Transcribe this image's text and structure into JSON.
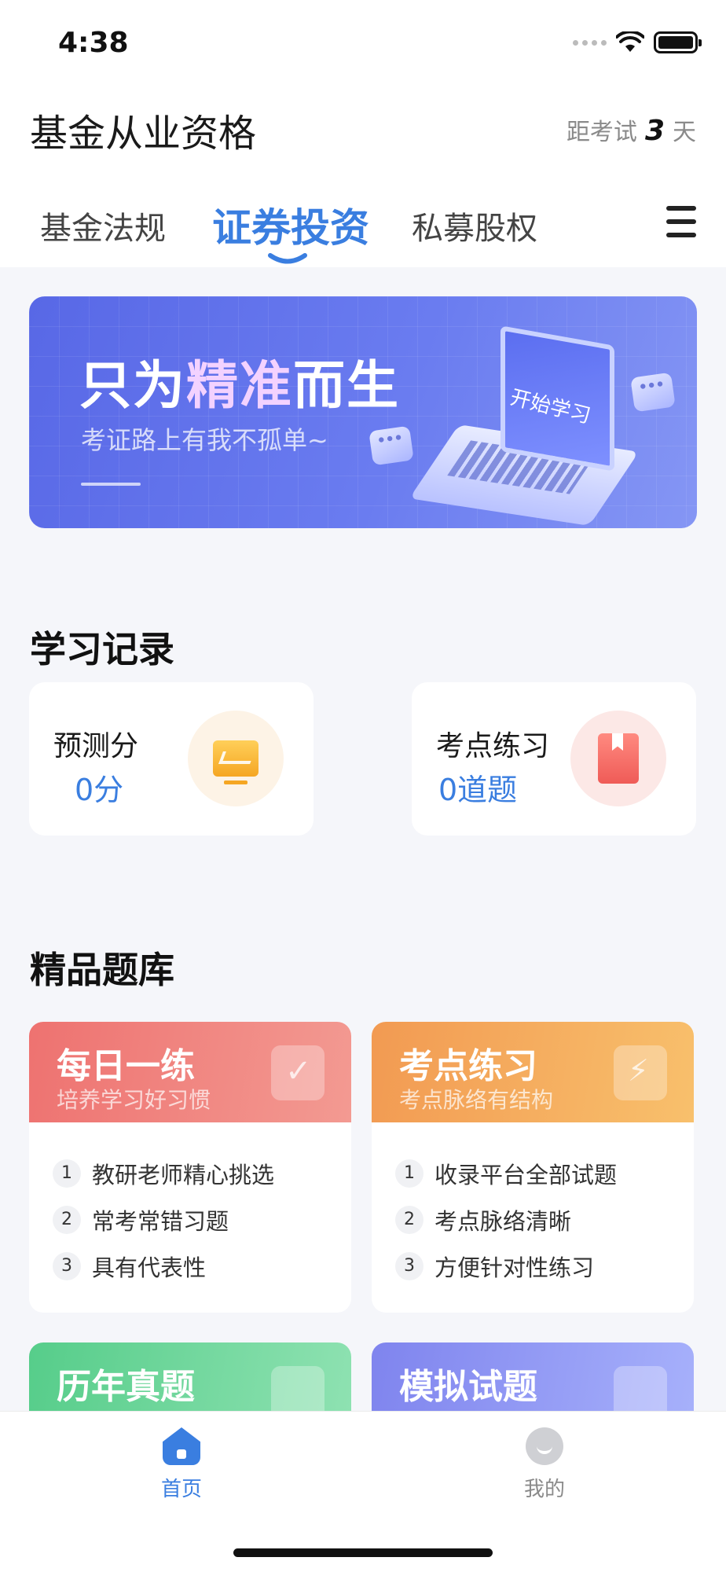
{
  "status_bar": {
    "time": "4:38"
  },
  "header": {
    "title": "基金从业资格",
    "exam_prefix": "距考试",
    "exam_days": "3",
    "exam_suffix": "天"
  },
  "tabs": [
    {
      "label": "基金法规"
    },
    {
      "label": "证券投资",
      "active": true
    },
    {
      "label": "私募股权"
    }
  ],
  "banner": {
    "title_part1": "只为",
    "title_highlight": "精准",
    "title_part2": "而生",
    "subtitle": "考证路上有我不孤单~",
    "screen_text": "开始学习"
  },
  "study_record": {
    "title": "学习记录",
    "cards": [
      {
        "label": "预测分",
        "value": "0分",
        "icon": "chart-icon"
      },
      {
        "label": "考点练习",
        "value": "0道题",
        "icon": "book-icon"
      }
    ]
  },
  "question_bank": {
    "title": "精品题库",
    "cards": [
      {
        "title": "每日一练",
        "subtitle": "培养学习好习惯",
        "icon": "calendar-check-icon",
        "items": [
          "教研老师精心挑选",
          "常考常错习题",
          "具有代表性"
        ]
      },
      {
        "title": "考点练习",
        "subtitle": "考点脉络有结构",
        "icon": "bolt-folder-icon",
        "items": [
          "收录平台全部试题",
          "考点脉络清晰",
          "方便针对性练习"
        ]
      },
      {
        "title": "历年真题",
        "icon": "document-icon"
      },
      {
        "title": "模拟试题",
        "icon": "bookmark-icon"
      }
    ]
  },
  "bottom_nav": {
    "home": "首页",
    "me": "我的"
  },
  "colors": {
    "accent": "#3a7ee0",
    "banner": "#5868e6"
  }
}
